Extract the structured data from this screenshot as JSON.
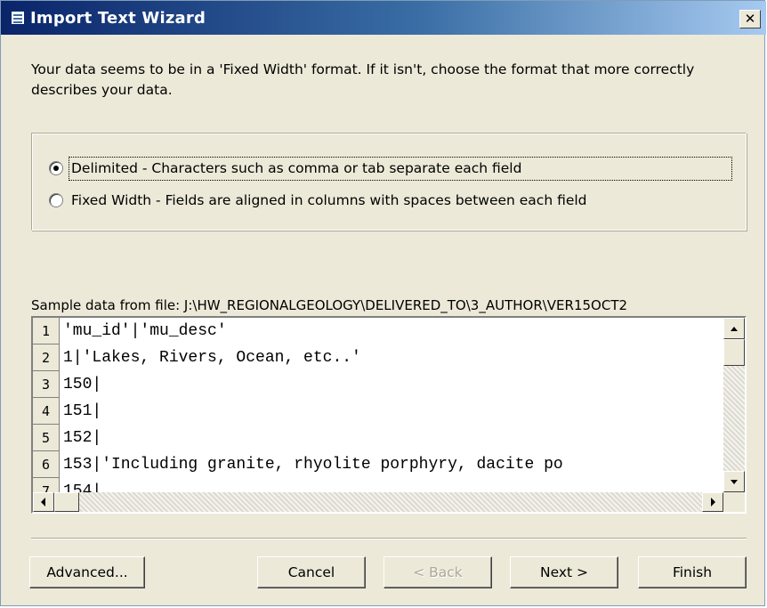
{
  "window": {
    "title": "Import Text Wizard",
    "close_label": "✕"
  },
  "intro_text": "Your data seems to be in a 'Fixed Width' format. If it isn't, choose the format that more correctly describes your data.",
  "format_options": [
    {
      "label": "Delimited - Characters such as comma or tab separate each field",
      "selected": true
    },
    {
      "label": "Fixed Width - Fields are aligned in columns with spaces between each field",
      "selected": false
    }
  ],
  "sample": {
    "label": "Sample data from file: J:\\HW_REGIONALGEOLOGY\\DELIVERED_TO\\3_AUTHOR\\VER15OCT2",
    "rows": [
      {
        "num": "1",
        "text": "'mu_id'|'mu_desc'"
      },
      {
        "num": "2",
        "text": "1|'Lakes, Rivers, Ocean, etc..'"
      },
      {
        "num": "3",
        "text": "150|"
      },
      {
        "num": "4",
        "text": "151|"
      },
      {
        "num": "5",
        "text": "152|"
      },
      {
        "num": "6",
        "text": "153|'Including granite, rhyolite porphyry, dacite po"
      },
      {
        "num": "7",
        "text": "154|"
      }
    ]
  },
  "buttons": {
    "advanced": "Advanced...",
    "cancel": "Cancel",
    "back": "< Back",
    "next": "Next >",
    "finish": "Finish"
  },
  "icons": {
    "title": "table-window-icon",
    "scroll_up": "arrow-up-icon",
    "scroll_down": "arrow-down-icon",
    "scroll_left": "arrow-left-icon",
    "scroll_right": "arrow-right-icon"
  }
}
